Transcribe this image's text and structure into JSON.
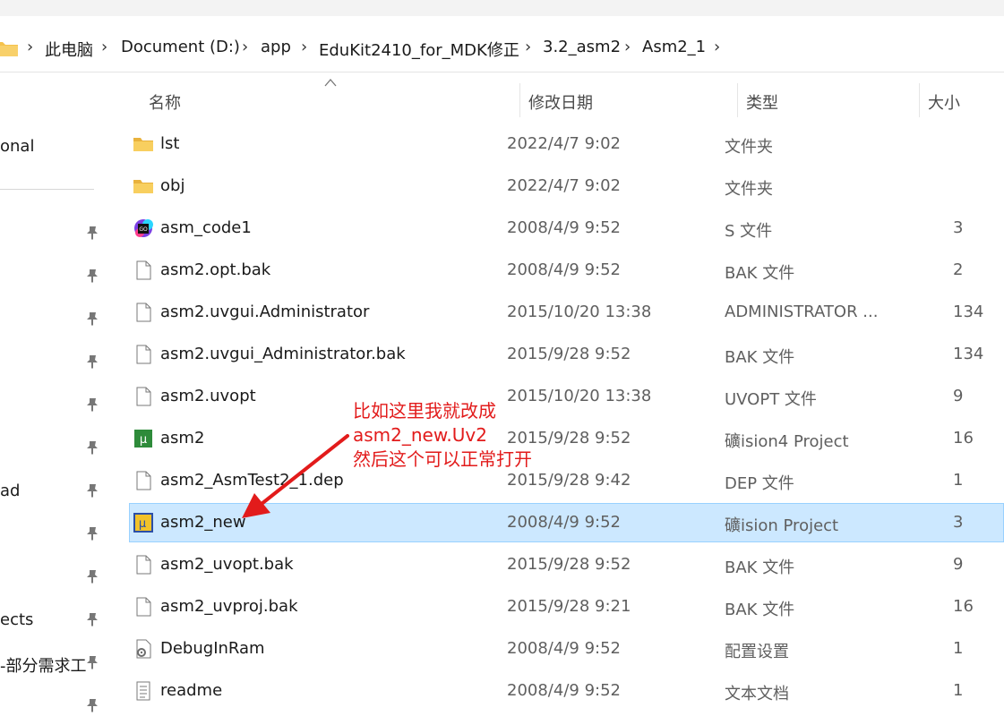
{
  "breadcrumb": [
    "此电脑",
    "Document (D:)",
    "app",
    "EduKit2410_for_MDK修正",
    "3.2_asm2",
    "Asm2_1"
  ],
  "sidebar": {
    "items": [
      {
        "label": "onal"
      },
      {
        "label": "ad"
      },
      {
        "label": "ects"
      },
      {
        "label": "-部分需求工"
      }
    ]
  },
  "columns": {
    "name": "名称",
    "date": "修改日期",
    "type": "类型",
    "size": "大小"
  },
  "files": [
    {
      "name": "lst",
      "date": "2022/4/7 9:02",
      "type": "文件夹",
      "size": "",
      "icon": "folder-icon"
    },
    {
      "name": "obj",
      "date": "2022/4/7 9:02",
      "type": "文件夹",
      "size": "",
      "icon": "folder-icon"
    },
    {
      "name": "asm_code1",
      "date": "2008/4/9 9:52",
      "type": "S 文件",
      "size": "3",
      "icon": "goland-icon"
    },
    {
      "name": "asm2.opt.bak",
      "date": "2008/4/9 9:52",
      "type": "BAK 文件",
      "size": "2",
      "icon": "file-icon"
    },
    {
      "name": "asm2.uvgui.Administrator",
      "date": "2015/10/20 13:38",
      "type": "ADMINISTRATOR ...",
      "size": "134",
      "icon": "file-icon"
    },
    {
      "name": "asm2.uvgui_Administrator.bak",
      "date": "2015/9/28 9:52",
      "type": "BAK 文件",
      "size": "134",
      "icon": "file-icon"
    },
    {
      "name": "asm2.uvopt",
      "date": "2015/10/20 13:38",
      "type": "UVOPT 文件",
      "size": "9",
      "icon": "file-icon"
    },
    {
      "name": "asm2",
      "date": "2015/9/28 9:52",
      "type": "礦ision4 Project",
      "size": "16",
      "icon": "uvision4-icon"
    },
    {
      "name": "asm2_AsmTest2_1.dep",
      "date": "2015/9/28 9:42",
      "type": "DEP 文件",
      "size": "1",
      "icon": "file-icon"
    },
    {
      "name": "asm2_new",
      "date": "2008/4/9 9:52",
      "type": "礦ision Project",
      "size": "3",
      "icon": "uvision-icon",
      "selected": true
    },
    {
      "name": "asm2_uvopt.bak",
      "date": "2015/9/28 9:52",
      "type": "BAK 文件",
      "size": "9",
      "icon": "file-icon"
    },
    {
      "name": "asm2_uvproj.bak",
      "date": "2015/9/28 9:21",
      "type": "BAK 文件",
      "size": "16",
      "icon": "file-icon"
    },
    {
      "name": "DebugInRam",
      "date": "2008/4/9 9:52",
      "type": "配置设置",
      "size": "1",
      "icon": "settings-file-icon"
    },
    {
      "name": "readme",
      "date": "2008/4/9 9:52",
      "type": "文本文档",
      "size": "1",
      "icon": "text-file-icon"
    }
  ],
  "annotation": {
    "lines": [
      "比如这里我就改成",
      "asm2_new.Uv2",
      "然后这个可以正常打开"
    ],
    "color": "#e21b1b"
  },
  "colors": {
    "selection": "#cce8ff",
    "folder": "#f5c24c"
  }
}
